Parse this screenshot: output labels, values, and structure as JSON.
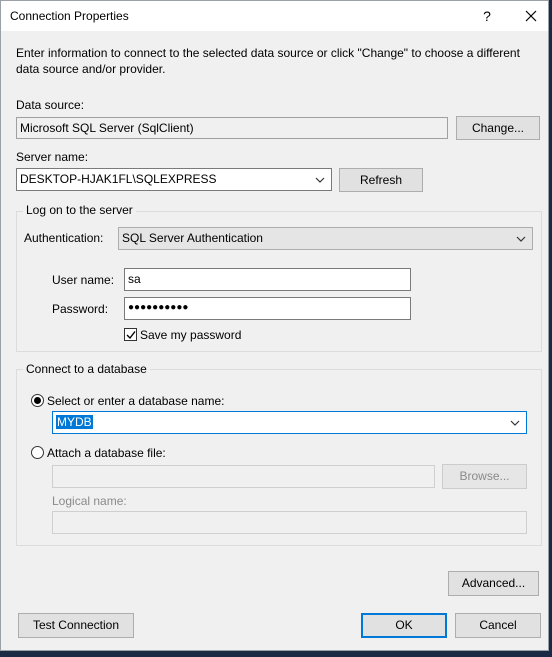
{
  "window": {
    "title": "Connection Properties",
    "help_label": "?",
    "close_label": "✕"
  },
  "intro": "Enter information to connect to the selected data source or click \"Change\" to choose a different data source and/or provider.",
  "data_source": {
    "label": "Data source:",
    "value": "Microsoft SQL Server (SqlClient)",
    "change_label": "Change..."
  },
  "server": {
    "label": "Server name:",
    "value": "DESKTOP-HJAK1FL\\SQLEXPRESS",
    "refresh_label": "Refresh"
  },
  "logon": {
    "title": "Log on to the server",
    "auth_label": "Authentication:",
    "auth_value": "SQL Server Authentication",
    "user_label": "User name:",
    "user_value": "sa",
    "password_label": "Password:",
    "password_value": "●●●●●●●●●●",
    "save_password_label": "Save my password",
    "save_password_checked": true
  },
  "database": {
    "title": "Connect to a database",
    "select_label": "Select or enter a database name:",
    "select_checked": true,
    "db_value": "MYDB",
    "attach_label": "Attach a database file:",
    "attach_checked": false,
    "browse_label": "Browse...",
    "logical_label": "Logical name:"
  },
  "buttons": {
    "advanced": "Advanced...",
    "test": "Test Connection",
    "ok": "OK",
    "cancel": "Cancel"
  }
}
